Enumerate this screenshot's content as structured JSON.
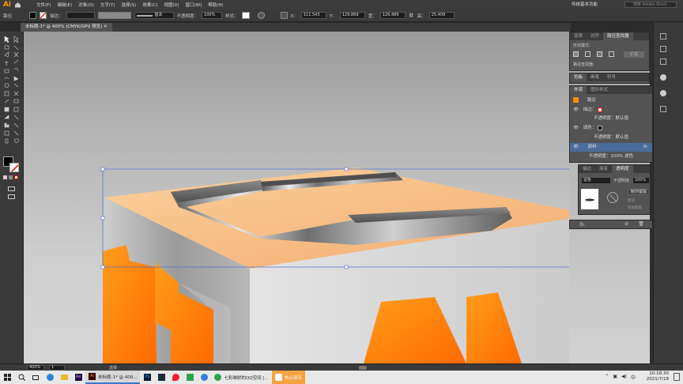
{
  "menubar": {
    "logo": "Ai",
    "items": [
      "文件(F)",
      "编辑(E)",
      "对象(O)",
      "文字(T)",
      "选择(S)",
      "效果(C)",
      "视图(V)",
      "窗口(W)",
      "帮助(H)"
    ],
    "workspace": "传统基本功能",
    "search_placeholder": "搜索 Adobe Stock"
  },
  "control": {
    "object_label": "路径",
    "stroke_label": "描边：",
    "brush_label": "基本",
    "opacity_label": "不透明度：",
    "opacity_value": "100%",
    "style_label": "样式：",
    "x_label": "X：",
    "x_value": "111.543",
    "y_label": "Y：",
    "y_value": "129.869",
    "w_label": "宽：",
    "w_value": "126.489",
    "h_label": "高：",
    "h_value": "25.409"
  },
  "document": {
    "tab_label": "未标题-1* @ 400% (CMYK/GPU 预览)"
  },
  "panels": {
    "top_tabs": [
      "变换",
      "对齐",
      "路径查找器"
    ],
    "shape_modes_label": "形状模式：",
    "expand_label": "扩展",
    "pathfinder_label": "路径查找器：",
    "color_tabs": [
      "色板",
      "画笔",
      "符号"
    ],
    "appearance_tabs": [
      "外观",
      "图形样式"
    ],
    "appearance_rows": {
      "path": "路径",
      "stroke": "描边：",
      "opacity1": "不透明度：默认值",
      "fill": "填色：",
      "opacity2": "不透明度：默认值",
      "selected": "颜料",
      "opacity3": "不透明度：100% 滤色"
    },
    "transparency_tabs": [
      "描边",
      "渐变",
      "透明度"
    ],
    "blend_mode": "滤色",
    "transp_opacity_label": "不透明度：",
    "transp_opacity_value": "100%",
    "make_mask": "制作蒙版",
    "clip": "剪切",
    "invert_mask": "反相蒙版"
  },
  "status": {
    "zoom": "400%",
    "artboard": "1",
    "tool": "选择"
  },
  "taskbar": {
    "tasks": [
      {
        "label": "未标题-1* @ 400..."
      },
      {
        "label": "七彩映射的QQ空间 [..."
      },
      {
        "label": "热点资讯"
      }
    ],
    "time": "10:18:30",
    "date": "2021/7/18"
  },
  "colors": {
    "accent": "#ff9a00",
    "selection": "#4a6c9b",
    "orange_face": "#ff8a0a",
    "sand": "#f7c08a"
  }
}
